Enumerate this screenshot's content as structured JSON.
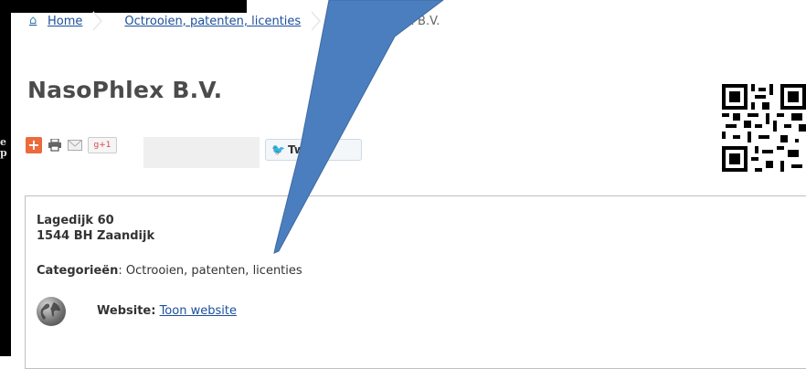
{
  "breadcrumb": {
    "home": "Home",
    "category": "Octrooien, patenten, licenties",
    "current": "x B.V."
  },
  "page_title": "NasoPhlex B.V.",
  "share": {
    "plus": "+",
    "gplus": "g+1",
    "tweet": "Twe"
  },
  "left_edge_text": "e\np",
  "address": {
    "line1": "Lagedijk 60",
    "line2": "1544 BH Zaandijk"
  },
  "categories": {
    "label": "Categorieën",
    "value": "Octrooien, patenten, licenties"
  },
  "website": {
    "label": "Website:",
    "link": "Toon website"
  },
  "colors": {
    "arrow": "#4a7ebf",
    "link": "#1b4f9c",
    "title": "#4b4b4b"
  },
  "icons": [
    "home-icon",
    "add-share-icon",
    "print-icon",
    "email-icon",
    "gplus-icon",
    "twitter-icon",
    "qr-code",
    "globe-icon"
  ]
}
